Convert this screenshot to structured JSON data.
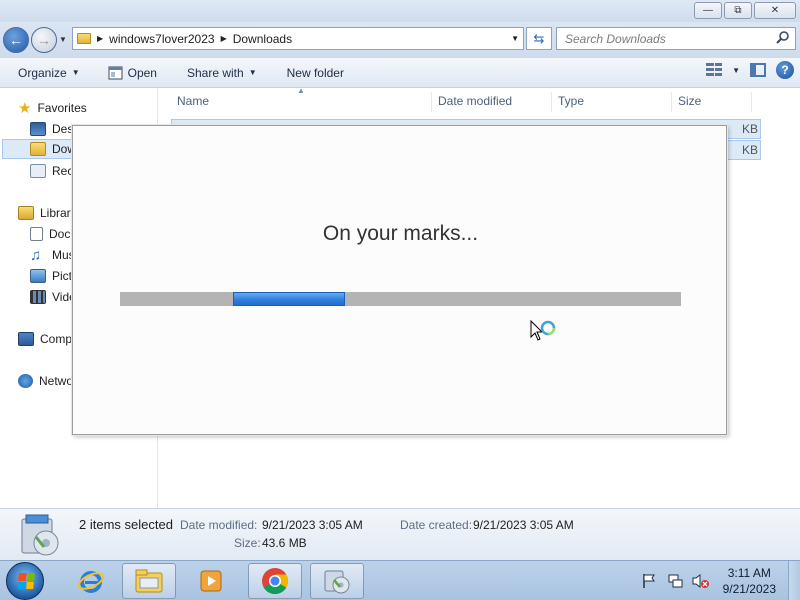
{
  "address": {
    "breadcrumbs": [
      "windows7lover2023",
      "Downloads"
    ],
    "search_placeholder": "Search Downloads"
  },
  "toolbar": {
    "organize": "Organize",
    "open": "Open",
    "share_with": "Share with",
    "new_folder": "New folder"
  },
  "navpane": {
    "favorites": "Favorites",
    "desktop": "Desk",
    "downloads": "Dow",
    "recent": "Rece",
    "libraries": "Librar",
    "documents": "Doc",
    "music": "Mus",
    "pictures": "Pict",
    "videos": "Vide",
    "computer": "Comp",
    "network": "Netwo"
  },
  "columns": {
    "name": "Name",
    "date_modified": "Date modified",
    "type": "Type",
    "size": "Size"
  },
  "rows": [
    {
      "size_suffix": "KB"
    },
    {
      "size_suffix": "KB"
    }
  ],
  "details": {
    "selection": "2 items selected",
    "date_modified_label": "Date modified:",
    "date_modified_value": "9/21/2023 3:05 AM",
    "date_created_label": "Date created:",
    "date_created_value": "9/21/2023 3:05 AM",
    "size_label": "Size:",
    "size_value": "43.6 MB"
  },
  "overlay": {
    "message": "On your marks...",
    "progress_state": "indeterminate"
  },
  "taskbar": {
    "time": "3:11 AM",
    "date": "9/21/2023"
  },
  "colors": {
    "progress_fill": "#2f7fdc",
    "progress_track": "#b4b4b4",
    "selection": "#dceaf8"
  }
}
